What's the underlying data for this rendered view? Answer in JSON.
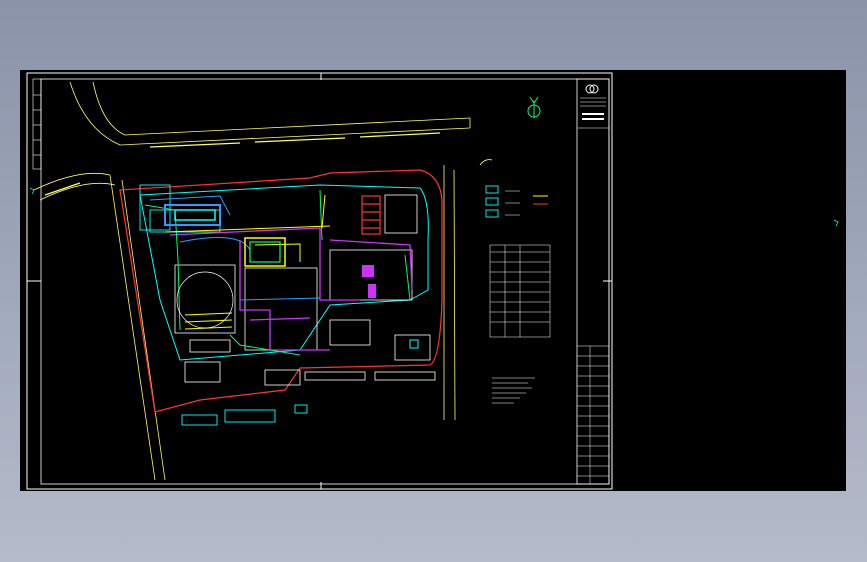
{
  "viewer": {
    "background_top": "#8a93a8",
    "background_bottom": "#b4bccb",
    "canvas_color": "#000000"
  },
  "drawing": {
    "frame_color": "#ffffff",
    "colors": {
      "road": "#ffff66",
      "building": "#ffffff",
      "property_line": "#ff3333",
      "pipe_cyan": "#00ffff",
      "pipe_magenta": "#cc33ff",
      "pipe_green": "#00ff66",
      "pipe_yellow": "#ffff00",
      "pipe_blue": "#3399ff"
    },
    "north_arrow_icon": "compass-north-icon",
    "title_block_logo_icon": "company-logo-icon"
  }
}
